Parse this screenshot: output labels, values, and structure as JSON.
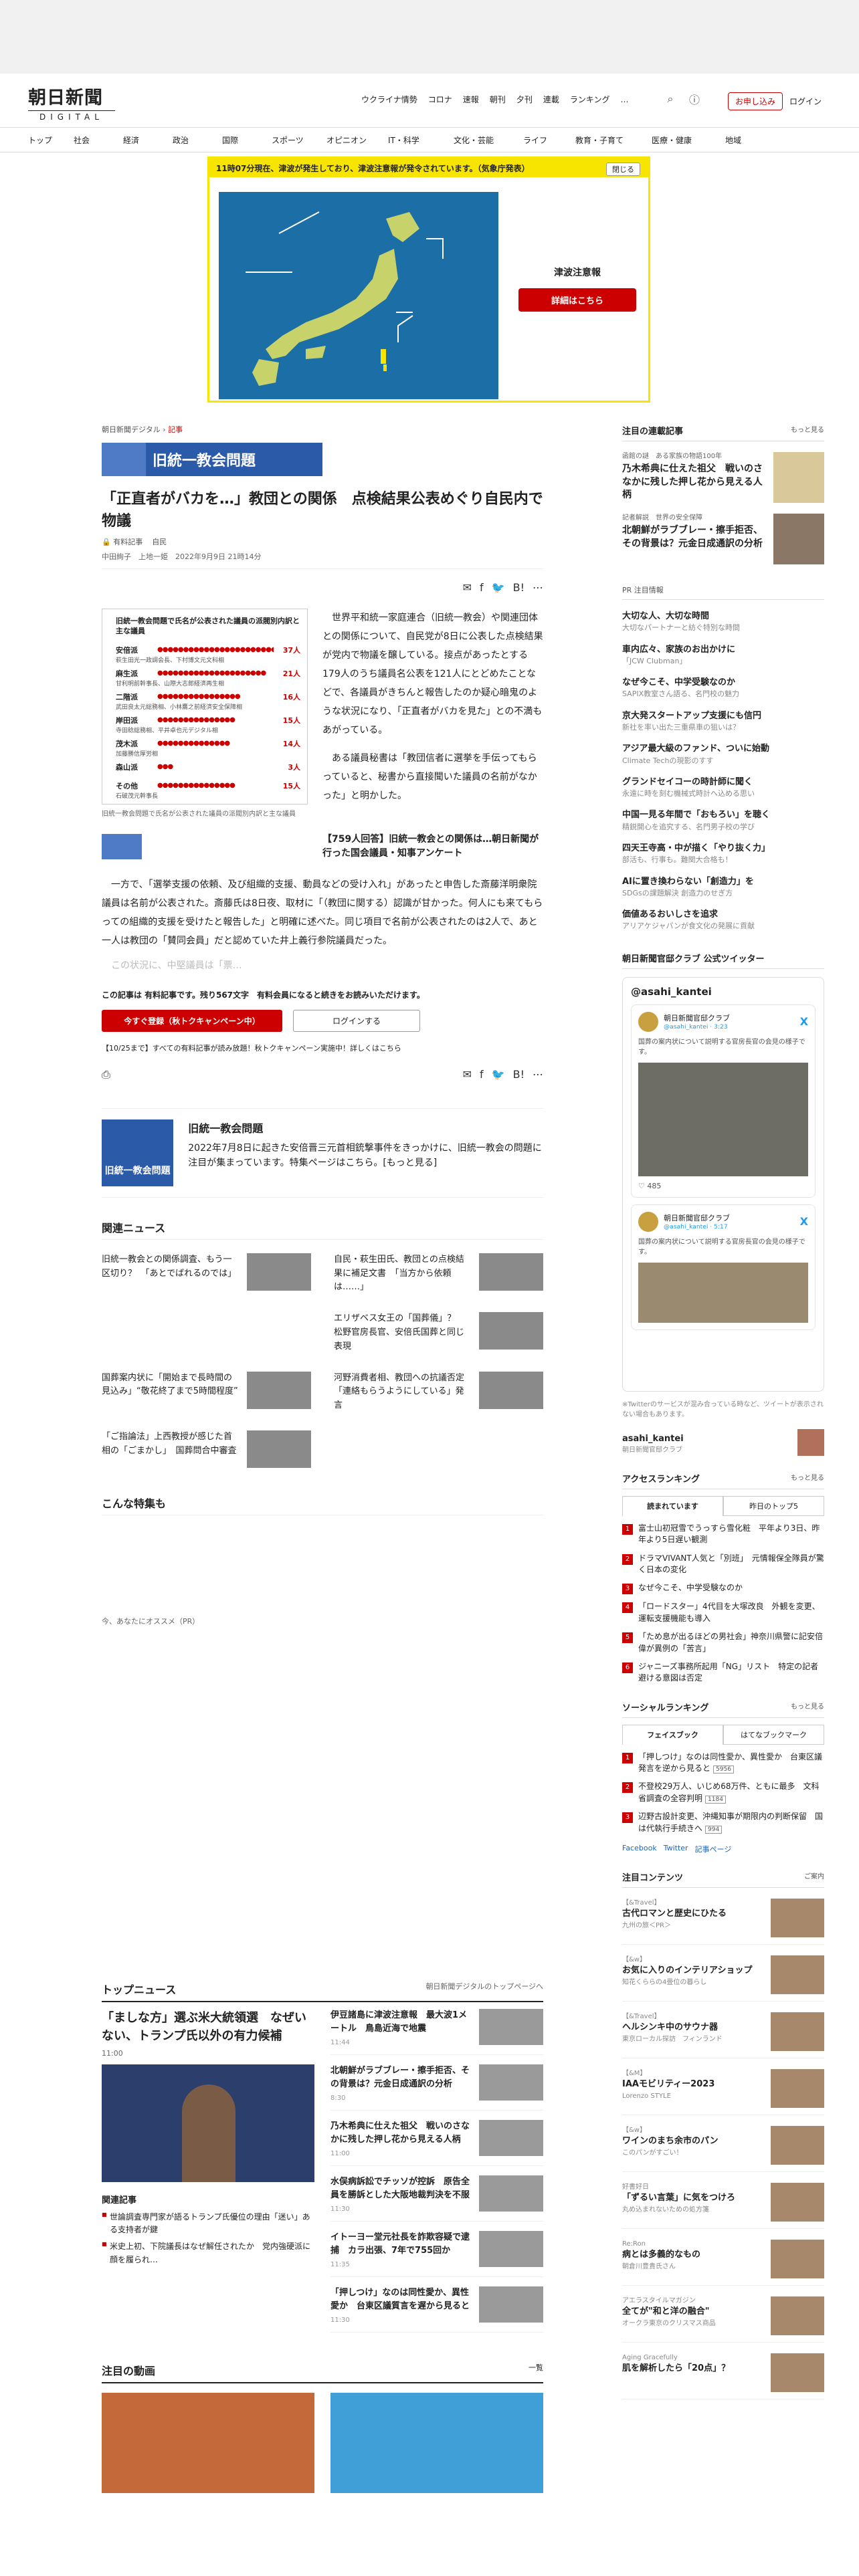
{
  "header": {
    "logo_jp": "朝日新聞",
    "logo_en": "DIGITAL",
    "topmenu": [
      "ウクライナ情勢",
      "コロナ",
      "速報",
      "朝刊",
      "夕刊",
      "連載",
      "ランキング"
    ],
    "more": "…",
    "apply": "お申し込み",
    "login": "ログイン"
  },
  "nav": [
    "トップ",
    "社会",
    "経済",
    "政治",
    "国際",
    "スポーツ",
    "オピニオン",
    "IT・科学",
    "文化・芸能",
    "ライフ",
    "教育・子育て",
    "医療・健康",
    "地域"
  ],
  "tsunami": {
    "bar": "11時07分現在、津波が発生しており、津波注意報が発令されています。（気象庁発表）",
    "close": "閉じる",
    "title": "津波注意報",
    "button": "詳細はこちら"
  },
  "article": {
    "crumb_site": "朝日新聞デジタル",
    "crumb_cat": "記事",
    "tag": "旧統一教会問題",
    "title": "「正直者がバカを…」教団との関係　点検結果公表めぐり自民内で物議",
    "lock_label": "有料記事",
    "party": "自民",
    "authors": "中田絢子　上地一姫",
    "date": "2022年9月9日 21時14分",
    "fig_title": "旧統一教会問題で氏名が公表された議員の派閥別内訳と主な議員",
    "fig_rows": [
      {
        "name": "安倍派",
        "count": "37人",
        "sub": "萩生田光一政調会長、下村博文元文科相"
      },
      {
        "name": "麻生派",
        "count": "21人",
        "sub": "甘利明前幹事長、山際大志郎経済再生相"
      },
      {
        "name": "二階派",
        "count": "16人",
        "sub": "武田良太元総務相、小林鷹之前経済安全保障相"
      },
      {
        "name": "岸田派",
        "count": "15人",
        "sub": "寺田稔総務相、平井卓也元デジタル相"
      },
      {
        "name": "茂木派",
        "count": "14人",
        "sub": "加藤勝信厚労相"
      },
      {
        "name": "森山派",
        "count": "3人",
        "sub": ""
      },
      {
        "name": "その他",
        "count": "15人",
        "sub": "石破茂元幹事長"
      }
    ],
    "fig_caption": "旧統一教会問題で氏名が公表された議員の派閥別内訳と主な議員",
    "p1": "世界平和統一家庭連合（旧統一教会）や関連団体との関係について、自民党が8日に公表した点検結果が党内で物議を醸している。接点があったとする179人のうち議員名公表を121人にとどめたことなどで、各議員がきちんと報告したのか疑心暗鬼のような状況になり、「正直者がバカを見た」との不満もあがっている。",
    "p2": "ある議員秘書は「教団信者に選挙を手伝ってもらっていると、秘書から直接聞いた議員の名前がなかった」と明かした。",
    "inline_related": "【759人回答】旧統一教会との関係は…朝日新聞が行った国会議員・知事アンケート",
    "p3": "一方で、「選挙支援の依頼、及び組織的支援、動員などの受け入れ」があったと申告した斎藤洋明衆院議員は名前が公表された。斎藤氏は8日夜、取材に「（教団に関する）認識が甘かった。何人にも来てもらっての組織的支援を受けたと報告した」と明確に述べた。同じ項目で名前が公表されたのは2人で、あと一人は教団の「賛同会員」だと認めていた井上義行参院議員だった。",
    "fade": "この状況に、中堅議員は「票…",
    "paywall": "この記事は 有料記事です。残り567文字　有料会員になると続きをお読みいただけます。",
    "btn_signup": "今すぐ登録（秋トクキャンペーン中）",
    "btn_login": "ログインする",
    "campaign": "【10/25まで】すべての有料記事が読み放題！秋トクキャンペーン実施中！詳しくはこちら"
  },
  "feature": {
    "banner": "旧統一教会問題",
    "title": "旧統一教会問題",
    "desc": "2022年7月8日に起きた安倍晋三元首相銃撃事件をきっかけに、旧統一教会の問題に注目が集まっています。特集ページはこちら。[もっと見る]"
  },
  "related_header": "関連ニュース",
  "related": [
    "旧統一教会との関係調査、もう一区切り？　「あとでばれるのでは」",
    "自民・萩生田氏、教団との点検結果に補足文書　「当方から依頼は……」",
    "",
    "エリザベス女王の「国葬儀」？　松野官房長官、安倍氏国葬と同じ表現",
    "国葬案内状に「開始まで長時間の見込み」“敬花終了まで5時間程度”",
    "河野消費者相、教団への抗議否定　「連絡もらうようにしている」発言",
    "「ご指論法」上西教授が感じた首相の「ごまかし」　国葬問合中審査",
    ""
  ],
  "konna": "こんな特集も",
  "osusume": "今、あなたにオススメ（PR）",
  "topnews": {
    "header": "トップニュース",
    "link": "朝日新聞デジタルのトップページへ",
    "main_title": "「ましな方」選ぶ米大統領選　なぜいない、トランプ氏以外の有力候補",
    "main_time": "11:00",
    "kanren": "関連記事",
    "kanren_items": [
      "世論調査専門家が語るトランプ氏優位の理由「迷い」ある支持者が鍵",
      "米史上初、下院議長はなぜ解任されたか　党内強硬派に顔を履られ…"
    ],
    "right": [
      {
        "t": "伊豆諸島に津波注意報　最大波1メートル　鳥島近海で地震",
        "tm": "11:44"
      },
      {
        "t": "北朝鮮がラブブレー・擦手拒否、その背景は？元金日成通訳の分析",
        "tm": "8:30"
      },
      {
        "t": "乃木希典に仕えた祖父　戦いのさなかに残した押し花から見える人柄",
        "tm": "11:00"
      },
      {
        "t": "水俣病訴訟でチッソが控訴　原告全員を勝訴とした大阪地裁判決を不服",
        "tm": "11:30"
      },
      {
        "t": "イトーヨー堂元社長を詐欺容疑で逮捕　カラ出張、7年で755回か",
        "tm": "11:35"
      },
      {
        "t": "「押しつけ」なのは同性愛か、異性愛か　台東区議質言を遅から見ると",
        "tm": "11:30"
      }
    ],
    "douga": "注目の動画",
    "douga_link": "一覧"
  },
  "side": {
    "serial_h": "注目の連載記事",
    "more": "もっと見る",
    "serial": [
      {
        "k": "函館の謎　ある家族の物語100年",
        "t": "乃木希典に仕えた祖父　戦いのさなかに残した押し花から見える人柄"
      },
      {
        "k": "記者解説　世界の安全保障",
        "t": "北朝鮮がラブブレー・擦手拒否、その背景は？元金日成通訳の分析"
      }
    ],
    "pr_h": "PR 注目情報",
    "pr": [
      {
        "t": "大切な人、大切な時間",
        "s": "大切なパートナーと紡ぐ特別な時間"
      },
      {
        "t": "車内広々、家族のお出かけに",
        "s": "「JCW Clubman」"
      },
      {
        "t": "なぜ今こそ、中学受験なのか",
        "s": "SAPIX教室さん語る、名門校の魅力"
      },
      {
        "t": "京大発スタートアップ支援にも信円",
        "s": "新社を率い出た三重県車の狙いは？"
      },
      {
        "t": "アジア最大級のファンド、ついに始動",
        "s": "Climate Techの現影のすす"
      },
      {
        "t": "グランドセイコーの時計師に聞く",
        "s": "永遠に時を刻む機械式時計へ込める思い"
      },
      {
        "t": "中国一見る年間で「おもろい」を聴く",
        "s": "精鋭開心を追究する、名門男子校の学び"
      },
      {
        "t": "四天王寺高・中が描く「やり抜く力」",
        "s": "部活も、行事も。難関大合格も！"
      },
      {
        "t": "AIに置き換わらない「創造力」を",
        "s": "SDGsの課題解決 創造力のせぎ方"
      },
      {
        "t": "価値あるおいしさを追求",
        "s": "アリアケジャパンが食文化の発展に貢献"
      }
    ],
    "tw_h": "朝日新聞官邸クラブ 公式ツイッター",
    "tw_account": "@asahi_kantei",
    "tw_user": "朝日新聞官邸クラブ",
    "tw_handle1": "@asahi_kantei · 3:23",
    "tw_handle2": "@asahi_kantei · 5:17",
    "tw_text": "国葬の案内状について説明する官房長官の会見の様子です。",
    "tw_likes": "485",
    "tw_note": "※Twitterのサービスが混み合っている時など、ツイートが表示されない場合もあります。",
    "tw_acc_name": "asahi_kantei",
    "tw_acc_sub": "朝日新聞官邸クラブ",
    "rank_h": "アクセスランキング",
    "rank_tabs": [
      "読まれています",
      "昨日のトップ5"
    ],
    "rank": [
      "富士山初冠雪でうっすら雪化粧　平年より3日、昨年より5日遅い観測",
      "ドラマVIVANT人気と「別班」　元情報保全隊員が驚く日本の変化",
      "なぜ今こそ、中学受験なのか",
      "「ロードスター」4代目を大塚改良　外観を変更、運転支援機能も導入",
      "「ため息が出るほどの男社会」神奈川県警に記安倍偉が異例の「苦言」",
      "ジャニーズ事務所起用「NG」リスト　特定の記者避ける意図は否定"
    ],
    "social_h": "ソーシャルランキング",
    "social_tabs": [
      "フェイスブック",
      "はてなブックマーク"
    ],
    "social": [
      {
        "t": "「押しつけ」なのは同性愛か、異性愛か　台東区議発言を逆から見ると",
        "c": "5956"
      },
      {
        "t": "不登校29万人、いじめ68万件、ともに最多　文科省調査の全容判明",
        "c": "1184"
      },
      {
        "t": "辺野古設計変更、沖縄知事が期限内の判断保留　国は代執行手続きへ",
        "c": "994"
      }
    ],
    "social_links": [
      "Facebook",
      "Twitter",
      "記事ページ"
    ],
    "sd_h": "注目コンテンツ",
    "sd_more": "ご案内",
    "sd": [
      {
        "k": "【&Travel】",
        "t": "古代ロマンと歴史にひたる",
        "s": "九州の旅＜PR＞"
      },
      {
        "k": "【&w】",
        "t": "お気に入りのインテリアショップ",
        "s": "知花くららの4畳位の暮らし"
      },
      {
        "k": "【&Travel】",
        "t": "ヘルシンキ中のサウナ器",
        "s": "東京ローカル探訪　フィンランド"
      },
      {
        "k": "【&M】",
        "t": "IAAモビリティー2023",
        "s": "Lorenzo STYLE"
      },
      {
        "k": "【&w】",
        "t": "ワインのまち余市のパン",
        "s": "このパンがすごい！"
      },
      {
        "k": "好書好日",
        "t": "「ずるい言葉」に気をつけろ",
        "s": "丸め込まれないための処方箋"
      },
      {
        "k": "Re:Ron",
        "t": "病とは多義的なもの",
        "s": "朝倉川豊貴氏さん"
      },
      {
        "k": "アエラスタイルマガジン",
        "t": "全てが\"和と洋の融合\"",
        "s": "オークラ東京のクリスマス商品"
      },
      {
        "k": "Aging Gracefully",
        "t": "肌を解析したら「20点」？",
        "s": ""
      }
    ]
  }
}
